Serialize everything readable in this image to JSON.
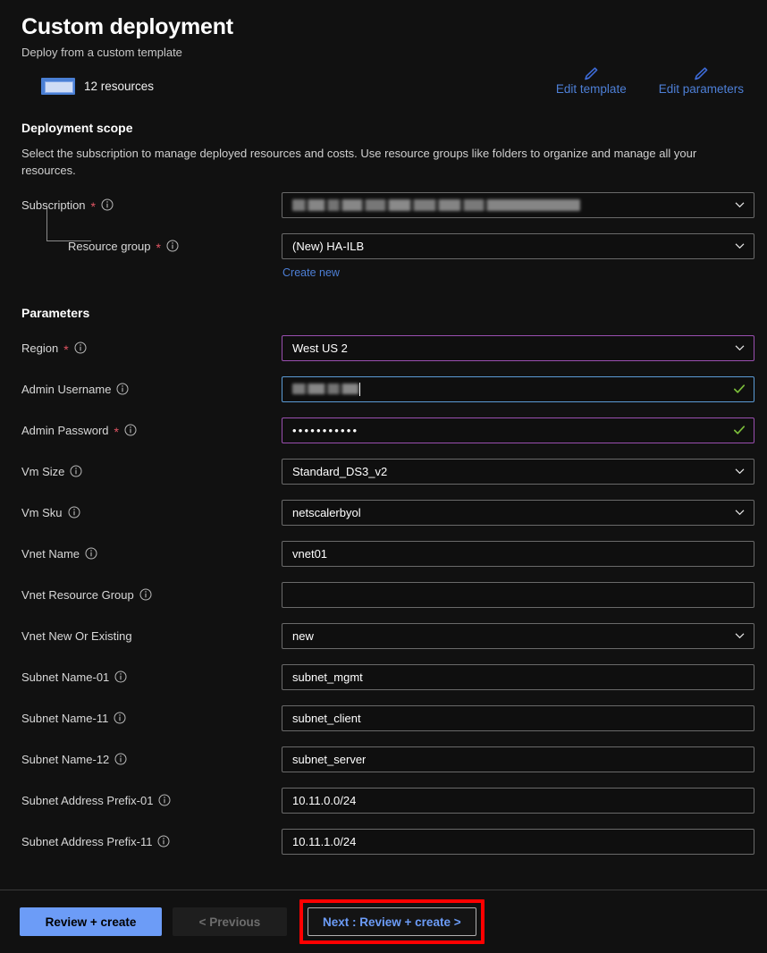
{
  "header": {
    "title": "Custom deployment",
    "subtitle": "Deploy from a custom template",
    "resources_count_label": "12 resources",
    "template_icon": "template-icon",
    "actions": [
      {
        "label": "Edit template",
        "icon": "pencil-icon"
      },
      {
        "label": "Edit parameters",
        "icon": "pencil-icon"
      }
    ]
  },
  "deployment_scope": {
    "section_title": "Deployment scope",
    "description": "Select the subscription to manage deployed resources and costs. Use resource groups like folders to organize and manage all your resources.",
    "subscription": {
      "label": "Subscription",
      "required": true,
      "info": true,
      "value": "",
      "redacted": true,
      "control": "select"
    },
    "resource_group": {
      "label": "Resource group",
      "required": true,
      "info": true,
      "value": "(New) HA-ILB",
      "control": "select",
      "create_new_label": "Create new"
    }
  },
  "parameters": {
    "section_title": "Parameters",
    "fields": [
      {
        "label": "Region",
        "required": true,
        "info": true,
        "value": "West US 2",
        "control": "select",
        "border": "purple"
      },
      {
        "label": "Admin Username",
        "required": false,
        "info": true,
        "value": "",
        "redacted": true,
        "control": "text",
        "border": "blue",
        "valid": true,
        "focused": true
      },
      {
        "label": "Admin Password",
        "required": true,
        "info": true,
        "value": "•••••••••••",
        "control": "password",
        "border": "purple",
        "valid": true
      },
      {
        "label": "Vm Size",
        "required": false,
        "info": true,
        "value": "Standard_DS3_v2",
        "control": "select"
      },
      {
        "label": "Vm Sku",
        "required": false,
        "info": true,
        "value": "netscalerbyol",
        "control": "select"
      },
      {
        "label": "Vnet Name",
        "required": false,
        "info": true,
        "value": "vnet01",
        "control": "text"
      },
      {
        "label": "Vnet Resource Group",
        "required": false,
        "info": true,
        "value": "",
        "control": "text"
      },
      {
        "label": "Vnet New Or Existing",
        "required": false,
        "info": false,
        "value": "new",
        "control": "select"
      },
      {
        "label": "Subnet Name-01",
        "required": false,
        "info": true,
        "value": "subnet_mgmt",
        "control": "text"
      },
      {
        "label": "Subnet Name-11",
        "required": false,
        "info": true,
        "value": "subnet_client",
        "control": "text"
      },
      {
        "label": "Subnet Name-12",
        "required": false,
        "info": true,
        "value": "subnet_server",
        "control": "text"
      },
      {
        "label": "Subnet Address Prefix-01",
        "required": false,
        "info": true,
        "value": "10.11.0.0/24",
        "control": "text"
      },
      {
        "label": "Subnet Address Prefix-11",
        "required": false,
        "info": true,
        "value": "10.11.1.0/24",
        "control": "text"
      }
    ]
  },
  "footer": {
    "review_create_label": "Review + create",
    "previous_label": "< Previous",
    "next_label": "Next : Review + create >",
    "next_highlighted": true
  },
  "colors": {
    "background": "#111111",
    "accent_blue": "#4d7fd6",
    "primary_button": "#6c9cf7",
    "required_star": "#e25563",
    "valid_check": "#7bbd3a",
    "focus_border": "#5b9bd5",
    "modified_border": "#9a4fb0",
    "highlight_red": "#ff0000"
  }
}
